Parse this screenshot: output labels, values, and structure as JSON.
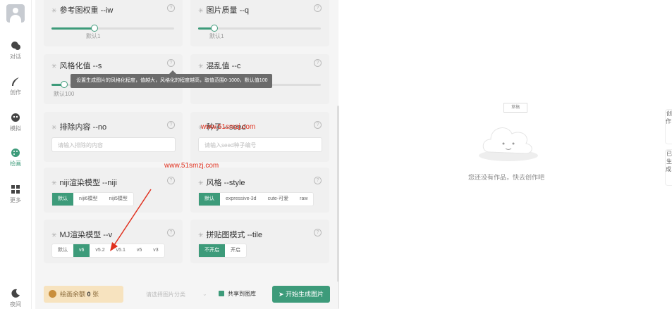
{
  "sidebar": {
    "items": [
      {
        "label": "对话",
        "icon": "chat-icon",
        "active": false
      },
      {
        "label": "创作",
        "icon": "feather-icon",
        "active": false
      },
      {
        "label": "模拟",
        "icon": "mask-icon",
        "active": false
      },
      {
        "label": "绘画",
        "icon": "palette-icon",
        "active": true
      },
      {
        "label": "更多",
        "icon": "grid-icon",
        "active": false
      }
    ],
    "night": {
      "label": "夜间",
      "icon": "moon-icon"
    }
  },
  "params": {
    "iw": {
      "title": "参考图权重 --iw",
      "default": "默认1",
      "value_fraction": 0.35
    },
    "q": {
      "title": "图片质量 --q",
      "default": "默认1",
      "value_fraction": 0.13
    },
    "s": {
      "title": "风格化值 --s",
      "default": "默认100",
      "value_fraction": 0.1
    },
    "c": {
      "title": "混乱值 --c",
      "value_fraction": 0.0
    },
    "no": {
      "title": "排除内容 --no",
      "placeholder": "请输入排除的内容"
    },
    "seed": {
      "title": "种子 --seed",
      "placeholder": "请输入seed种子编号"
    },
    "niji": {
      "title": "niji渲染模型 --niji",
      "options": [
        "默认",
        "niji6模型",
        "niji5模型"
      ],
      "selected": 0
    },
    "style": {
      "title": "风格 --style",
      "options": [
        "默认",
        "expressive-3d",
        "cute-可爱",
        "raw"
      ],
      "selected": 0
    },
    "mj": {
      "title": "MJ渲染模型 --v",
      "options": [
        "默认",
        "v6",
        "v5.2",
        "v5.1",
        "v5",
        "v3"
      ],
      "selected": 1
    },
    "tile": {
      "title": "拼贴图模式 --tile",
      "options": [
        "不开启",
        "开启"
      ],
      "selected": 0
    }
  },
  "tooltip": "设置生成图片的风格化程度，值越大，风格化的程度越高，取值范围0-1000，默认值100",
  "watermarks": [
    "www.51smzj.com",
    "www.51smzj.com"
  ],
  "bottom": {
    "balance_label": "绘画余额",
    "balance_value": "0",
    "balance_unit": "张",
    "category_placeholder": "请选择图片分类",
    "share_label": "共享到图库",
    "generate_label": "开始生成图片"
  },
  "gallery": {
    "tag": "草稿",
    "empty_text": "您还没有作品，快去创作吧"
  },
  "edge_tabs": [
    "创作…",
    "已生成…"
  ],
  "colors": {
    "accent": "#3d9b7a",
    "balance_bg": "#f7e3bf",
    "watermark": "#e0301e"
  }
}
